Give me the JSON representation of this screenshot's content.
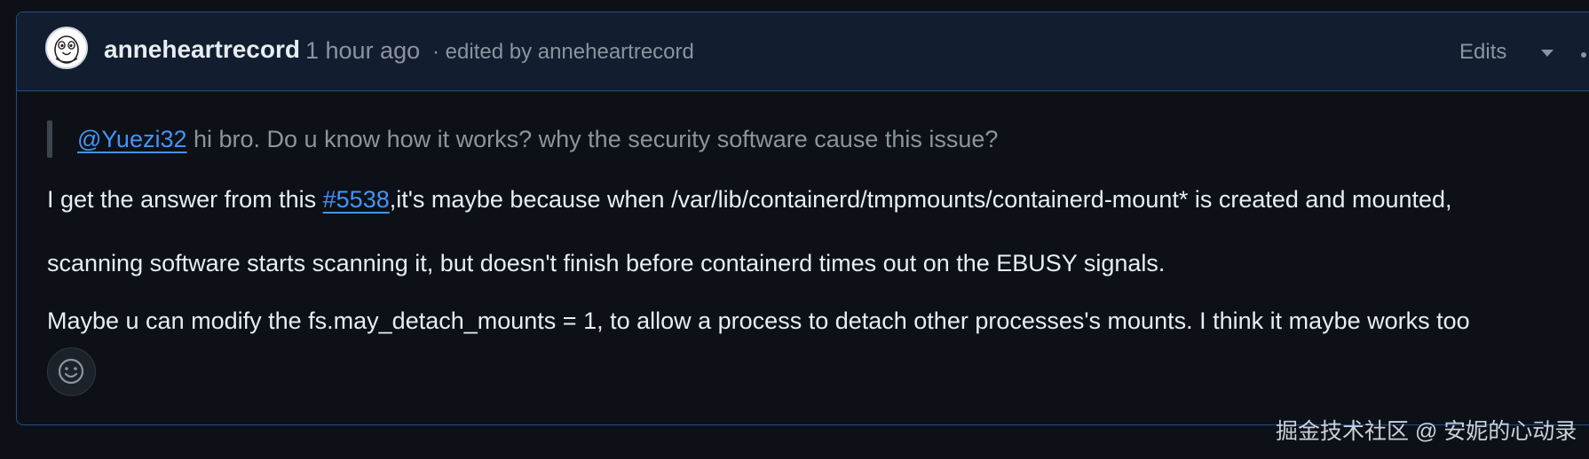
{
  "comment": {
    "author": "anneheartrecord",
    "time": "1 hour ago",
    "edited": "· edited by anneheartrecord",
    "edits_label": "Edits",
    "avatar_icon": "penguin-avatar-icon",
    "menu_icon": "kebab-icon"
  },
  "body": {
    "quote_mention": "@Yuezi32",
    "quote_text": " hi bro. Do u know how it works? why the security software cause this issue?",
    "p1_before": "I get the answer from this ",
    "p1_link": "#5538",
    "p1_after": ",it's maybe because when /var/lib/containerd/tmpmounts/containerd-mount* is created and mounted,",
    "p2": "scanning software starts scanning it, but doesn't finish before containerd times out on the EBUSY signals.",
    "p3": "Maybe u can modify the fs.may_detach_mounts = 1, to allow a process to detach other processes's mounts. I think it maybe works too"
  },
  "reaction_icon": "smiley-icon",
  "watermark": "掘金技术社区 @ 安妮的心动录",
  "colors": {
    "background": "#0d1117",
    "header": "#121d2f",
    "border": "#1f4f8a",
    "link": "#4493f8",
    "muted": "#8b949e",
    "text": "#e6edf3"
  }
}
